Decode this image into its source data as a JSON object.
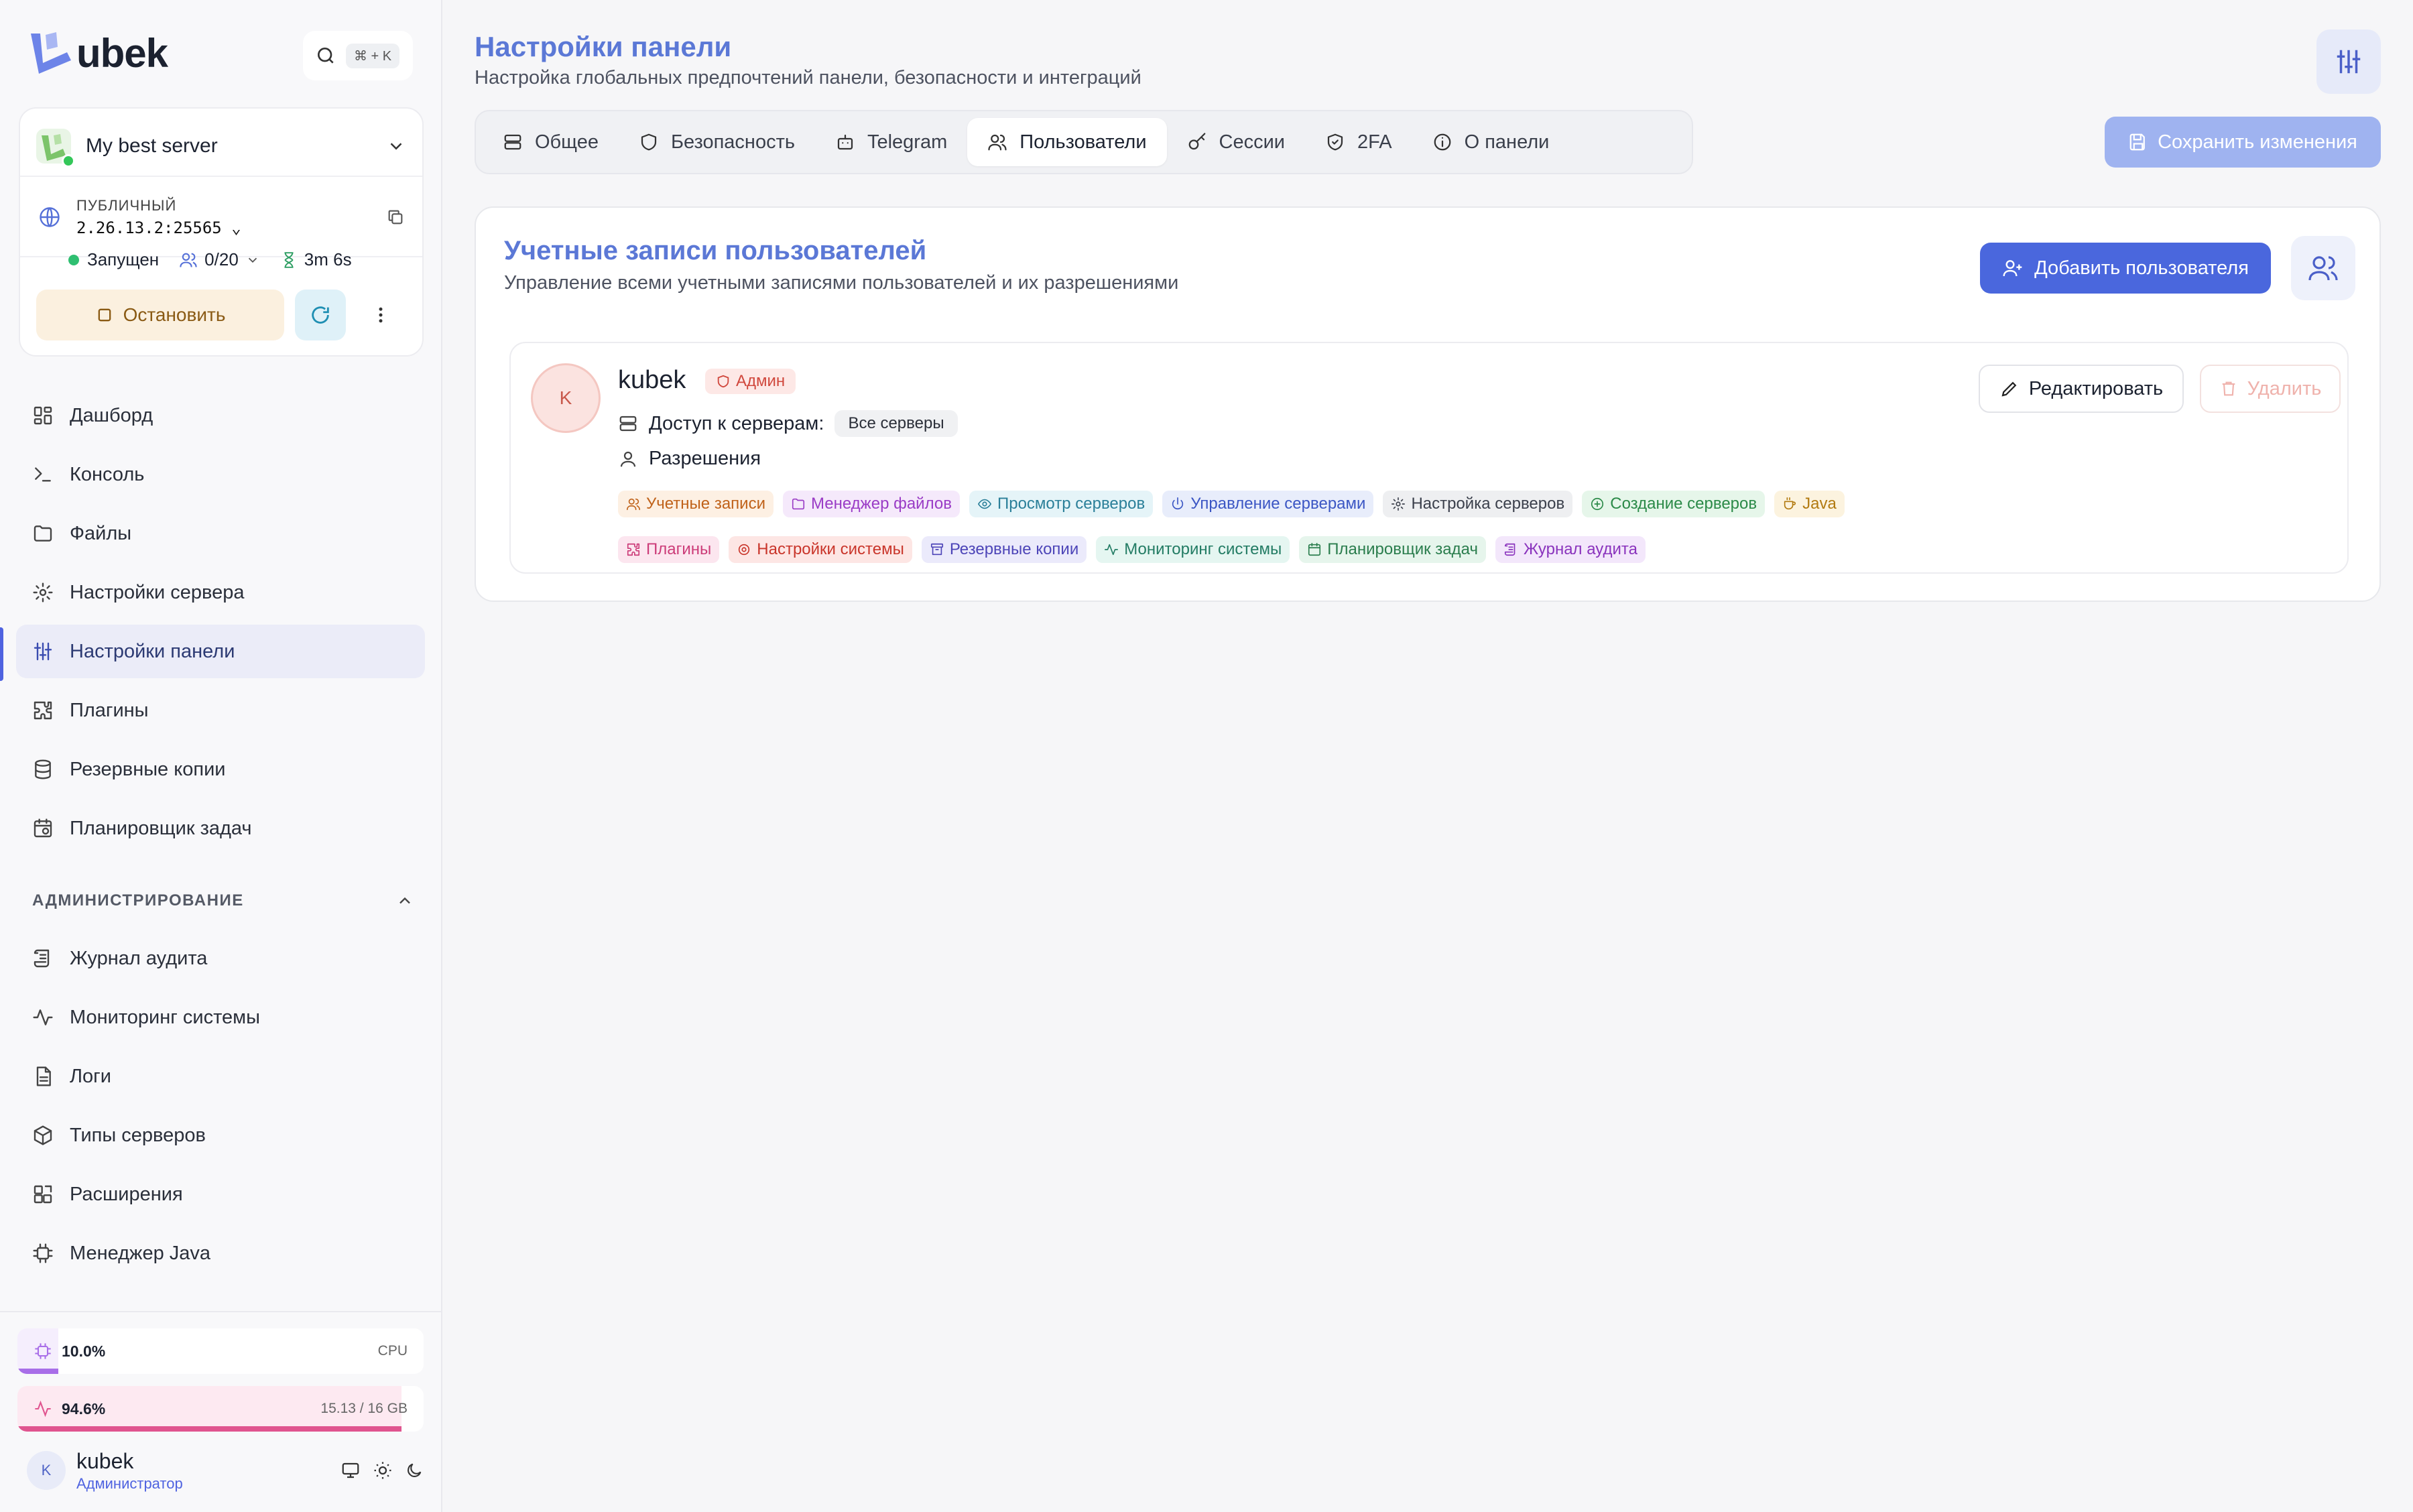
{
  "app": {
    "logo_text": "ubek",
    "search_shortcut": "⌘ + K"
  },
  "server": {
    "name": "My best server",
    "ip_label": "ПУБЛИЧНЫЙ",
    "ip_value": "2.26.13.2:25565",
    "status": "Запущен",
    "players": "0/20",
    "uptime": "3m 6s",
    "stop_label": "Остановить"
  },
  "sidebar": {
    "items": [
      {
        "label": "Дашборд",
        "icon": "dashboard-icon"
      },
      {
        "label": "Консоль",
        "icon": "terminal-icon"
      },
      {
        "label": "Файлы",
        "icon": "folder-icon"
      },
      {
        "label": "Настройки сервера",
        "icon": "gear-icon"
      },
      {
        "label": "Настройки панели",
        "icon": "sliders-icon",
        "active": true
      },
      {
        "label": "Плагины",
        "icon": "puzzle-icon"
      },
      {
        "label": "Резервные копии",
        "icon": "database-icon"
      },
      {
        "label": "Планировщик задач",
        "icon": "calendar-clock-icon"
      }
    ],
    "admin_section_title": "АДМИНИСТРИРОВАНИЕ",
    "admin_items": [
      {
        "label": "Журнал аудита",
        "icon": "scroll-icon"
      },
      {
        "label": "Мониторинг системы",
        "icon": "activity-icon"
      },
      {
        "label": "Логи",
        "icon": "file-text-icon"
      },
      {
        "label": "Типы серверов",
        "icon": "package-icon"
      },
      {
        "label": "Расширения",
        "icon": "blocks-icon"
      },
      {
        "label": "Менеджер Java",
        "icon": "cpu-icon"
      }
    ]
  },
  "resources": {
    "cpu": {
      "percent_text": "10.0%",
      "label": "CPU",
      "fraction": 0.1,
      "color": "#a86ee8"
    },
    "ram": {
      "percent_text": "94.6%",
      "label": "15.13 / 16 GB",
      "fraction": 0.946,
      "color": "#e0548f"
    }
  },
  "current_user": {
    "initial": "K",
    "name": "kubek",
    "role": "Администратор"
  },
  "page": {
    "title": "Настройки панели",
    "subtitle": "Настройка глобальных предпочтений панели, безопасности и интеграций",
    "save_label": "Сохранить изменения"
  },
  "tabs": [
    {
      "label": "Общее",
      "icon": "server-icon"
    },
    {
      "label": "Безопасность",
      "icon": "shield-icon"
    },
    {
      "label": "Telegram",
      "icon": "bot-icon"
    },
    {
      "label": "Пользователи",
      "icon": "users-icon",
      "active": true
    },
    {
      "label": "Сессии",
      "icon": "key-icon"
    },
    {
      "label": "2FA",
      "icon": "shield-check-icon"
    },
    {
      "label": "О панели",
      "icon": "info-icon"
    }
  ],
  "users_panel": {
    "title": "Учетные записи пользователей",
    "subtitle": "Управление всеми учетными записями пользователей и их разрешениями",
    "add_label": "Добавить пользователя"
  },
  "user_card": {
    "initial": "K",
    "name": "kubek",
    "badge": "Админ",
    "servers_label": "Доступ к серверам:",
    "servers_value": "Все серверы",
    "permissions_label": "Разрешения",
    "edit_label": "Редактировать",
    "delete_label": "Удалить",
    "permissions": [
      {
        "label": "Учетные записи",
        "bg": "#fdf0e3",
        "fg": "#c0621a",
        "icon": "users-icon"
      },
      {
        "label": "Менеджер файлов",
        "bg": "#f5e9fb",
        "fg": "#9a3cc6",
        "icon": "folder-icon"
      },
      {
        "label": "Просмотр серверов",
        "bg": "#e5f4f8",
        "fg": "#2a7f99",
        "icon": "eye-icon"
      },
      {
        "label": "Управление серверами",
        "bg": "#e8edfb",
        "fg": "#3b56c4",
        "icon": "power-icon"
      },
      {
        "label": "Настройка серверов",
        "bg": "#eeeff1",
        "fg": "#3a3f4b",
        "icon": "gear-icon"
      },
      {
        "label": "Создание серверов",
        "bg": "#e6f6ea",
        "fg": "#2b8a48",
        "icon": "plus-circle-icon"
      },
      {
        "label": "Java",
        "bg": "#fcf3df",
        "fg": "#b27a10",
        "icon": "coffee-icon"
      },
      {
        "label": "Плагины",
        "bg": "#fce6ef",
        "fg": "#cc3c79",
        "icon": "puzzle-icon"
      },
      {
        "label": "Настройки системы",
        "bg": "#fde6e4",
        "fg": "#c9352a",
        "icon": "cog-icon"
      },
      {
        "label": "Резервные копии",
        "bg": "#ebeafb",
        "fg": "#4d45b8",
        "icon": "archive-icon"
      },
      {
        "label": "Мониторинг системы",
        "bg": "#e5f6f1",
        "fg": "#237c64",
        "icon": "activity-icon"
      },
      {
        "label": "Планировщик задач",
        "bg": "#e6f5ec",
        "fg": "#2a7d4d",
        "icon": "calendar-icon"
      },
      {
        "label": "Журнал аудита",
        "bg": "#f3e7fb",
        "fg": "#8a33bd",
        "icon": "scroll-icon"
      }
    ]
  }
}
